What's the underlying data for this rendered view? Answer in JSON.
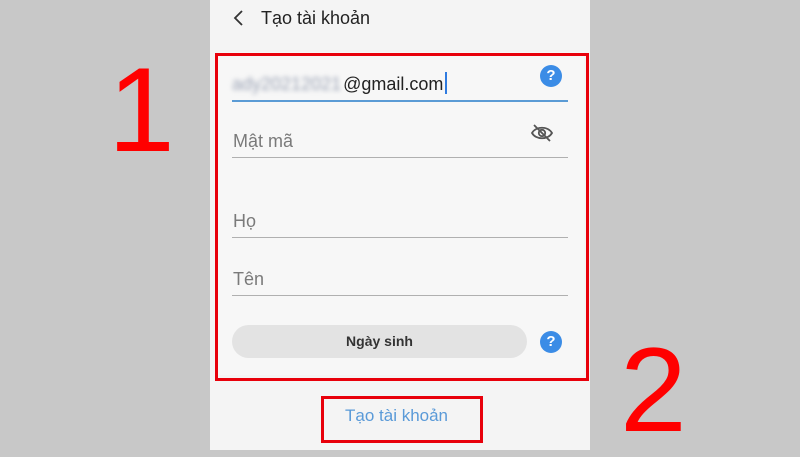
{
  "header": {
    "title": "Tạo tài khoản"
  },
  "form": {
    "email": {
      "blurred_prefix": "ady20212021",
      "value": "@gmail.com"
    },
    "password_placeholder": "Mật mã",
    "lastname_placeholder": "Họ",
    "firstname_placeholder": "Tên",
    "birthday_label": "Ngày sinh",
    "help_glyph": "?"
  },
  "footer": {
    "create_label": "Tạo tài khoản"
  },
  "annotations": {
    "step1": "1",
    "step2": "2"
  },
  "colors": {
    "highlight": "#e8000b",
    "accent": "#3b8ce6",
    "link": "#5a9ad8",
    "annotation_number": "#ff0000"
  },
  "icons": [
    "back-arrow-icon",
    "help-icon",
    "eye-slash-icon"
  ]
}
